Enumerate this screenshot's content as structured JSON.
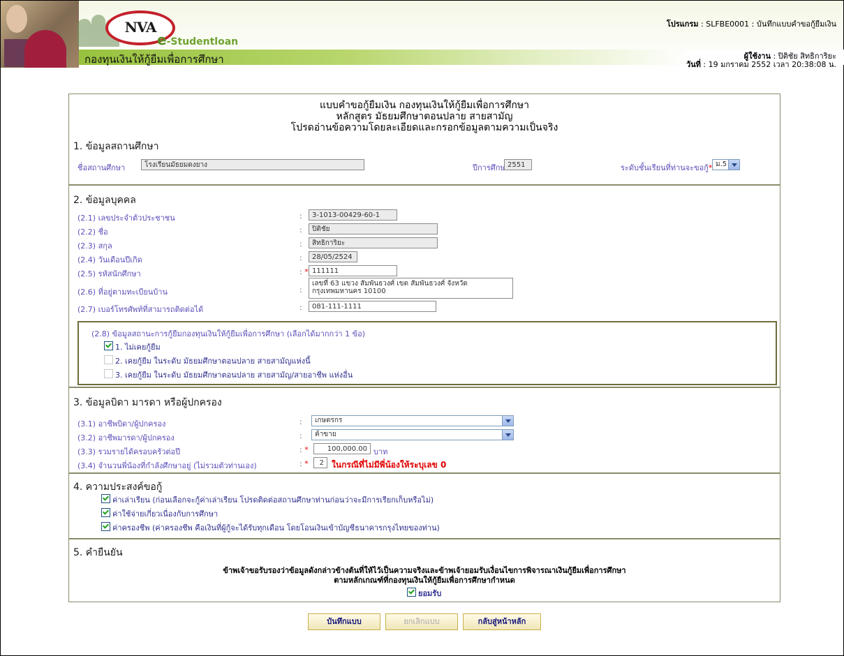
{
  "header": {
    "logo_text": "NVA",
    "e_prefix": "e",
    "e_suffix": "-Studentloan",
    "fund_name": "กองทุนเงินให้กู้ยืมเพื่อการศึกษา",
    "program_label": "โปรแกรม",
    "program_value": " : SLFBE0001 : บันทึกแบบคำขอกู้ยืมเงิน",
    "user_label": "ผู้ใช้งาน",
    "user_value": " : ปิติชัย สิทธิการิยะ",
    "date_label": "วันที่",
    "date_value": " : 19 มกราคม 2552 เวลา 20:38:08 น."
  },
  "form": {
    "title_lines": [
      "แบบคำขอกู้ยืมเงิน กองทุนเงินให้กู้ยืมเพื่อการศึกษา",
      "หลักสูตร มัธยมศึกษาตอนปลาย สายสามัญ",
      "โปรดอ่านข้อความโดยละเอียดและกรอกข้อมูลตามความเป็นจริง"
    ],
    "section1": {
      "heading": "1. ข้อมูลสถานศึกษา",
      "school_label": "ชื่อสถานศึกษา",
      "school_value": "โรงเรียนมัธยมดงยาง",
      "year_label": "ปีการศึกษา",
      "year_value": "2551",
      "level_label": "ระดับชั้นเรียนที่ท่านจะขอกู้",
      "level_value": "ม.5"
    },
    "section2": {
      "heading": "2. ข้อมูลบุคคล",
      "rows": [
        {
          "label": "(2.1) เลขประจำตัวประชาชน",
          "value": "3-1013-00429-60-1",
          "required": false
        },
        {
          "label": "(2.2) ชื่อ",
          "value": "ปิติชัย",
          "required": false
        },
        {
          "label": "(2.3) สกุล",
          "value": "สิทธิการิยะ",
          "required": false
        },
        {
          "label": "(2.4) วันเดือนปีเกิด",
          "value": "28/05/2524",
          "required": false
        },
        {
          "label": "(2.5) รหัสนักศึกษา",
          "value": "111111",
          "required": true
        },
        {
          "label": "(2.6) ที่อยู่ตามทะเบียนบ้าน",
          "value": "เลขที่ 63 แขวง สัมพันธวงศ์ เขต สัมพันธวงศ์ จังหวัด กรุงเทพมหานคร 10100",
          "required": false
        },
        {
          "label": "(2.7) เบอร์โทรศัพท์ที่สามารถติดต่อได้",
          "value": "081-111-1111",
          "required": false
        }
      ],
      "loan_status_title": "(2.8) ข้อมูลสถานะการกู้ยืมกองทุนเงินให้กู้ยืมเพื่อการศึกษา (เลือกได้มากกว่า 1 ข้อ)",
      "loan_status_options": [
        {
          "label": "1. ไม่เคยกู้ยืม",
          "checked": true
        },
        {
          "label": "2. เคยกู้ยืม ในระดับ มัธยมศึกษาตอนปลาย สายสามัญแห่งนี้",
          "checked": false
        },
        {
          "label": "3. เคยกู้ยืม ในระดับ มัธยมศึกษาตอนปลาย สายสามัญ/สายอาชีพ แห่งอื่น",
          "checked": false
        }
      ]
    },
    "section3": {
      "heading": "3. ข้อมูลบิดา มารดา หรือผู้ปกครอง",
      "father_job_label": "(3.1) อาชีพบิดา/ผู้ปกครอง",
      "father_job_value": "เกษตรกร",
      "mother_job_label": "(3.2) อาชีพมารดา/ผู้ปกครอง",
      "mother_job_value": "ค้าขาย",
      "income_label": "(3.3) รวมรายได้ครอบครัวต่อปี",
      "income_value": "100,000.00",
      "income_unit": "บาท",
      "siblings_label": "(3.4) จำนวนพี่น้องที่กำลังศึกษาอยู่ (ไม่รวมตัวท่านเอง)",
      "siblings_value": "2",
      "siblings_note": "ในกรณีที่ไม่มีพี่น้องให้ระบุเลข 0"
    },
    "section4": {
      "heading": "4. ความประสงค์ขอกู้",
      "options": [
        {
          "label": "ค่าเล่าเรียน (ก่อนเลือกจะกู้ค่าเล่าเรียน โปรดติดต่อสถานศึกษาท่านก่อนว่าจะมีการเรียกเก็บหรือไม่)",
          "checked": true
        },
        {
          "label": "ค่าใช้จ่ายเกี่ยวเนื่องกับการศึกษา",
          "checked": true
        },
        {
          "label": "ค่าครองชีพ (ค่าครองชีพ คือเงินที่ผู้กู้จะได้รับทุกเดือน โดยโอนเงินเข้าบัญชีธนาคารกรุงไทยของท่าน)",
          "checked": true
        }
      ]
    },
    "section5": {
      "heading": "5. คำยืนยัน",
      "line1": "ข้าพเจ้าขอรับรองว่าข้อมูลดังกล่าวข้างต้นที่ให้ไว้เป็นความจริงและข้าพเจ้ายอมรับเงื่อนไขการพิจารณาเงินกู้ยืมเพื่อการศึกษา",
      "line2": "ตามหลักเกณฑ์ที่กองทุนเงินให้กู้ยืมเพื่อการศึกษากำหนด",
      "accept_label": "ยอมรับ",
      "accept_checked": true
    }
  },
  "buttons": {
    "save": "บันทึกแบบ",
    "cancel": "ยกเลิกแบบ",
    "home": "กลับสู่หน้าหลัก"
  }
}
